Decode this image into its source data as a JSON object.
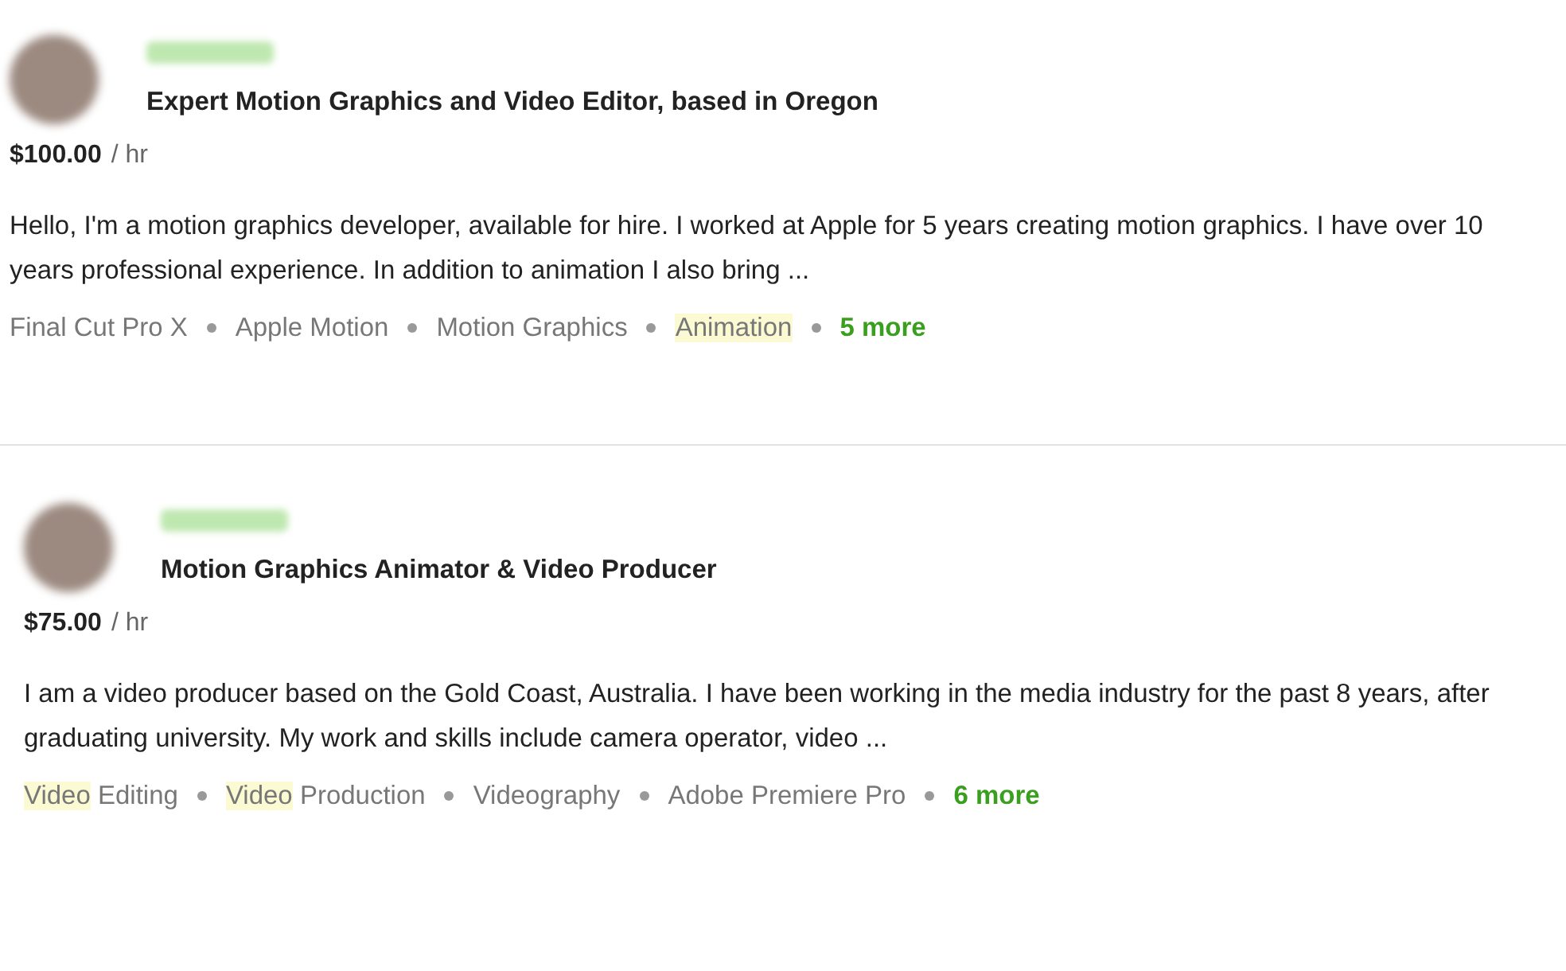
{
  "freelancers": [
    {
      "title": "Expert Motion Graphics and Video Editor, based in Oregon",
      "rate": "$100.00",
      "rate_unit": "/ hr",
      "description": "Hello, I'm a motion graphics developer, available for hire. I worked at Apple for 5 years creating motion graphics. I have over 10 years professional experience. In addition to animation I also bring ...",
      "skills": [
        {
          "parts": [
            {
              "text": "Final Cut Pro X",
              "highlighted": false
            }
          ]
        },
        {
          "parts": [
            {
              "text": "Apple Motion",
              "highlighted": false
            }
          ]
        },
        {
          "parts": [
            {
              "text": "Motion Graphics",
              "highlighted": false
            }
          ]
        },
        {
          "parts": [
            {
              "text": "Animation",
              "highlighted": true
            }
          ]
        }
      ],
      "more": "5 more"
    },
    {
      "title": "Motion Graphics Animator & Video Producer",
      "rate": "$75.00",
      "rate_unit": "/ hr",
      "description": "I am a video producer based on the Gold Coast, Australia. I have been working in the media industry for the past 8 years, after graduating university. My work and skills include camera operator, video ...",
      "skills": [
        {
          "parts": [
            {
              "text": "Video",
              "highlighted": true
            },
            {
              "text": " Editing",
              "highlighted": false
            }
          ]
        },
        {
          "parts": [
            {
              "text": "Video",
              "highlighted": true
            },
            {
              "text": " Production",
              "highlighted": false
            }
          ]
        },
        {
          "parts": [
            {
              "text": "Videography",
              "highlighted": false
            }
          ]
        },
        {
          "parts": [
            {
              "text": "Adobe Premiere Pro",
              "highlighted": false
            }
          ]
        }
      ],
      "more": "6 more"
    }
  ]
}
